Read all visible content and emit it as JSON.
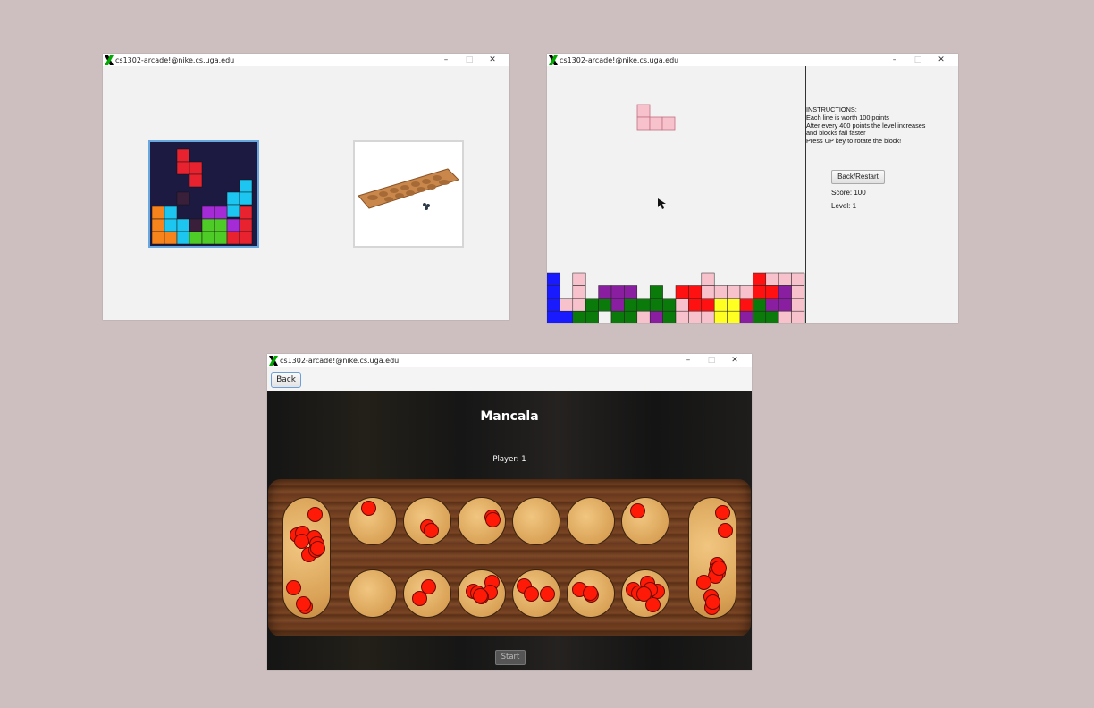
{
  "screen": {
    "background": "#cdbfbf"
  },
  "windows": {
    "menu": {
      "title": "cs1302-arcade!@nike.cs.uga.edu",
      "controls": {
        "minimize": "–",
        "maximize": "□",
        "close": "✕"
      },
      "games": [
        {
          "name": "tetris-tile"
        },
        {
          "name": "mancala-tile"
        }
      ]
    },
    "tetris": {
      "title": "cs1302-arcade!@nike.cs.uga.edu",
      "controls": {
        "minimize": "–",
        "maximize": "□",
        "close": "✕"
      },
      "instructions": "INSTRUCTIONS:\nEach line is worth 100 points\nAfter every 400 points the level increases\nand blocks fall faster\nPress UP key to rotate the block!",
      "restart_button": "Back/Restart",
      "score": "Score: 100",
      "level": "Level: 1"
    },
    "mancala": {
      "title": "cs1302-arcade!@nike.cs.uga.edu",
      "controls": {
        "minimize": "–",
        "maximize": "□",
        "close": "✕"
      },
      "back_button": "Back",
      "game_title": "Mancala",
      "player": "Player: 1",
      "start_button": "Start",
      "stones": {
        "left_store": 12,
        "right_store": 11,
        "top_pits": [
          1,
          2,
          2,
          0,
          0,
          1
        ],
        "bottom_pits": [
          0,
          2,
          6,
          3,
          3,
          7
        ]
      }
    }
  }
}
